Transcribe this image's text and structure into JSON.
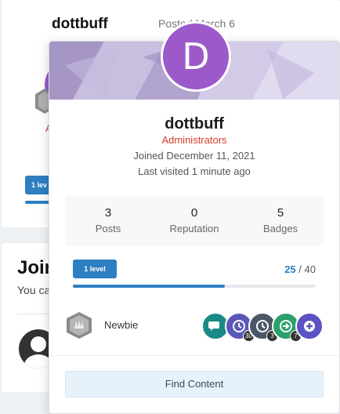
{
  "background": {
    "post_author": "dottbuff",
    "posted_text": "Posted March 6",
    "group_fragment": "A",
    "level_fragment": "1 lev",
    "join_title": "Join",
    "you_can_text": "You ca"
  },
  "hovercard": {
    "avatar_letter": "D",
    "username": "dottbuff",
    "group": "Administrators",
    "joined": "Joined December 11, 2021",
    "last_visited": "Last visited 1 minute ago",
    "stats": [
      {
        "value": "3",
        "label": "Posts"
      },
      {
        "value": "0",
        "label": "Reputation"
      },
      {
        "value": "5",
        "label": "Badges"
      }
    ],
    "level_badge": "1 level",
    "progress": {
      "current": "25",
      "separator": "/",
      "total": "40",
      "fraction": 0.625
    },
    "rank": "Newbie",
    "badges": [
      {
        "icon": "speech-bubbles-icon",
        "color": "#1a8a86",
        "count": ""
      },
      {
        "icon": "clock-icon",
        "color": "#5a57b8",
        "count": "30"
      },
      {
        "icon": "clock-icon",
        "color": "#4b5667",
        "count": "3"
      },
      {
        "icon": "arrow-right-circle-icon",
        "color": "#2aa06a",
        "count": "7"
      },
      {
        "icon": "plus-circle-icon",
        "color": "#5b53c4",
        "count": ""
      }
    ],
    "find_content": "Find Content"
  },
  "colors": {
    "accent": "#2d7fc1",
    "group_red": "#d83a2e",
    "avatar_purple": "#9b59c9"
  }
}
